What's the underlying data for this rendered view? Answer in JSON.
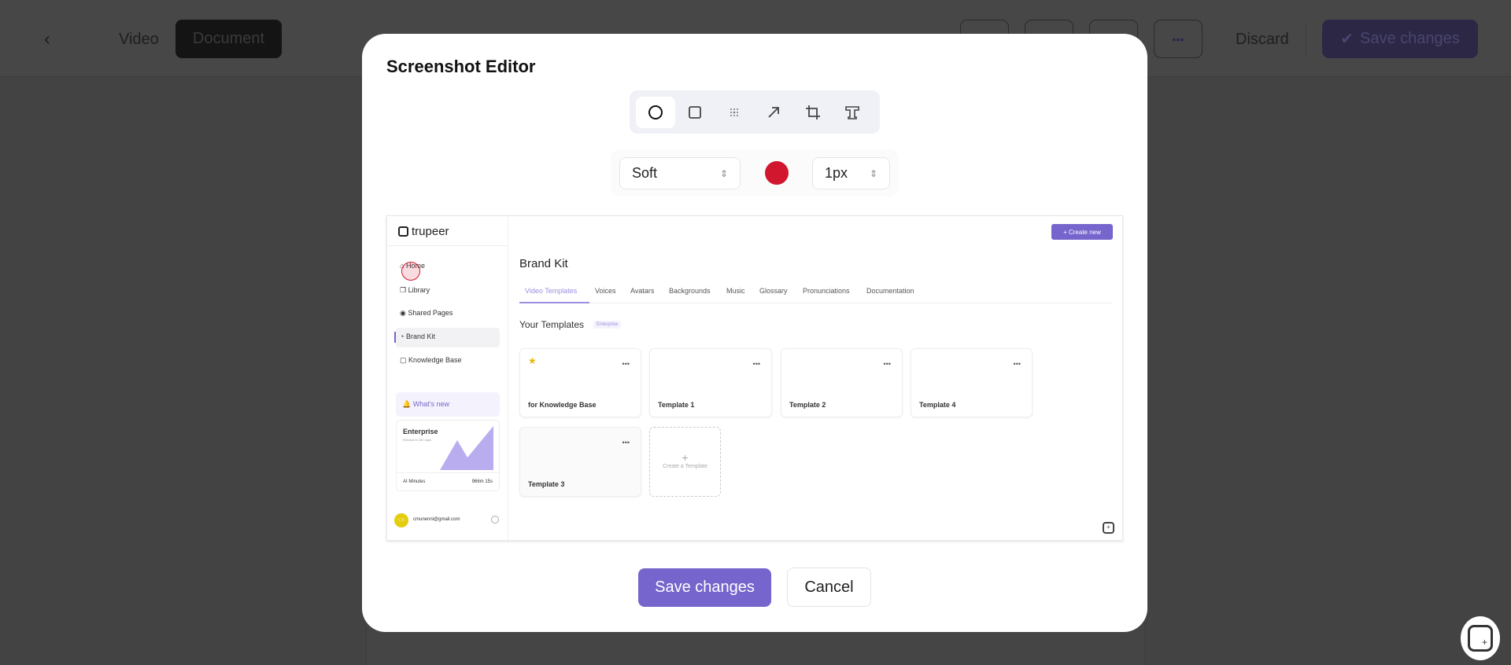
{
  "topbar": {
    "tabs": [
      "Video",
      "Document"
    ],
    "active_tab": "Document",
    "discard_label": "Discard",
    "save_label": "Save changes",
    "more_icon": "more-horizontal-icon"
  },
  "modal": {
    "title": "Screenshot Editor",
    "tools": [
      "circle-icon",
      "square-icon",
      "blur-icon",
      "arrow-icon",
      "crop-icon",
      "text-icon"
    ],
    "active_tool": "circle",
    "style_select": "Soft",
    "color": "#d0172d",
    "width_select": "1px",
    "save_label": "Save changes",
    "cancel_label": "Cancel",
    "accent": "#7565cc"
  },
  "screenshot": {
    "logo": "trupeer",
    "nav": [
      "Home",
      "Library",
      "Shared Pages",
      "Brand Kit",
      "Knowledge Base"
    ],
    "active_nav": "Brand Kit",
    "whats_new": "What's new",
    "plan": {
      "name": "Enterprise",
      "subtitle": "Renews in 330 days",
      "metric_label": "AI Minutes",
      "metric_value": "966m 15s"
    },
    "user_initials": "CM",
    "user_email": "cmunenni@gmail.com",
    "create_new": "+ Create new",
    "page_title": "Brand Kit",
    "tabs": [
      "Video Templates",
      "Voices",
      "Avatars",
      "Backgrounds",
      "Music",
      "Glossary",
      "Pronunciations",
      "Documentation"
    ],
    "active_tab": "Video Templates",
    "section_title": "Your Templates",
    "section_badge": "Enterprise",
    "templates": [
      "for Knowledge Base",
      "Template 1",
      "Template 2",
      "Template 4",
      "Template 3"
    ],
    "create_template": "Create a Template"
  }
}
